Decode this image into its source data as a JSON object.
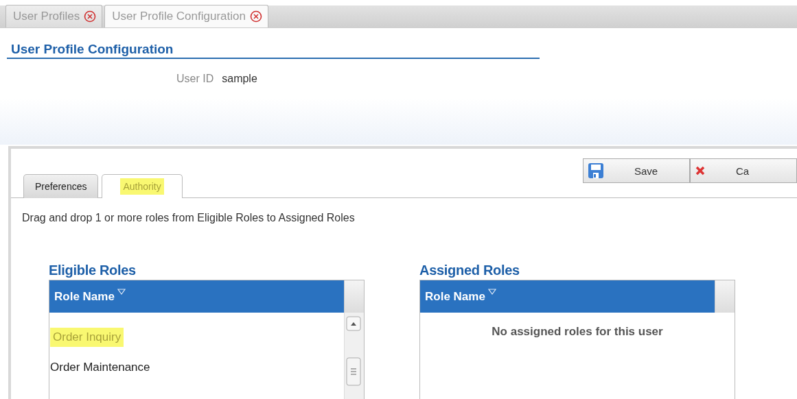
{
  "top_tabs": [
    {
      "label": "User Profiles",
      "selected": false
    },
    {
      "label": "User Profile Configuration",
      "selected": true
    }
  ],
  "page_title": "User Profile Configuration",
  "user_id": {
    "label": "User ID",
    "value": "sample"
  },
  "toolbar": {
    "buttons": [
      {
        "kind": "save",
        "label": "Save"
      },
      {
        "kind": "cancel",
        "label": "Ca"
      }
    ]
  },
  "panel_tabs": [
    {
      "label": "Preferences",
      "selected": false,
      "highlighted": false
    },
    {
      "label": "Authority",
      "selected": true,
      "highlighted": true
    }
  ],
  "instructions": "Drag and drop 1 or more roles from Eligible Roles to Assigned Roles",
  "eligible_roles": {
    "title": "Eligible Roles",
    "column": "Role Name",
    "rows": [
      {
        "label": "Order Inquiry",
        "highlighted": true
      },
      {
        "label": "Order Maintenance",
        "highlighted": false
      }
    ]
  },
  "assigned_roles": {
    "title": "Assigned Roles",
    "column": "Role Name",
    "empty_message": "No assigned roles for this user"
  }
}
